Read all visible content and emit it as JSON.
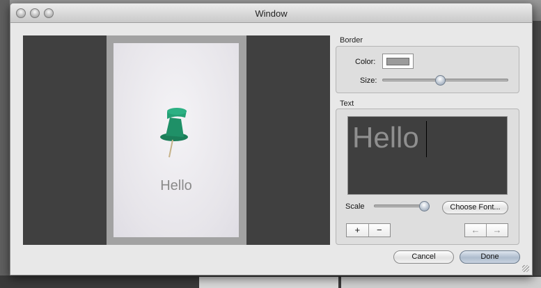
{
  "window": {
    "title": "Window"
  },
  "preview": {
    "caption": "Hello"
  },
  "border": {
    "group_label": "Border",
    "color_label": "Color:",
    "size_label": "Size:",
    "color": "#9b9b9b",
    "size_value": 0.46
  },
  "text": {
    "group_label": "Text",
    "editor_value": "Hello",
    "scale_label": "Scale",
    "scale_value": 0.9,
    "choose_font_label": "Choose Font...",
    "add_label": "+",
    "remove_label": "−",
    "left_label": "←",
    "right_label": "→"
  },
  "buttons": {
    "cancel_label": "Cancel",
    "done_label": "Done"
  },
  "icons": {
    "pin": "pushpin-icon",
    "grip": "resize-grip-icon"
  },
  "colors": {
    "preview_bg": "#404040",
    "frame": "#a2a2a2",
    "pin": "#1d8b64"
  }
}
